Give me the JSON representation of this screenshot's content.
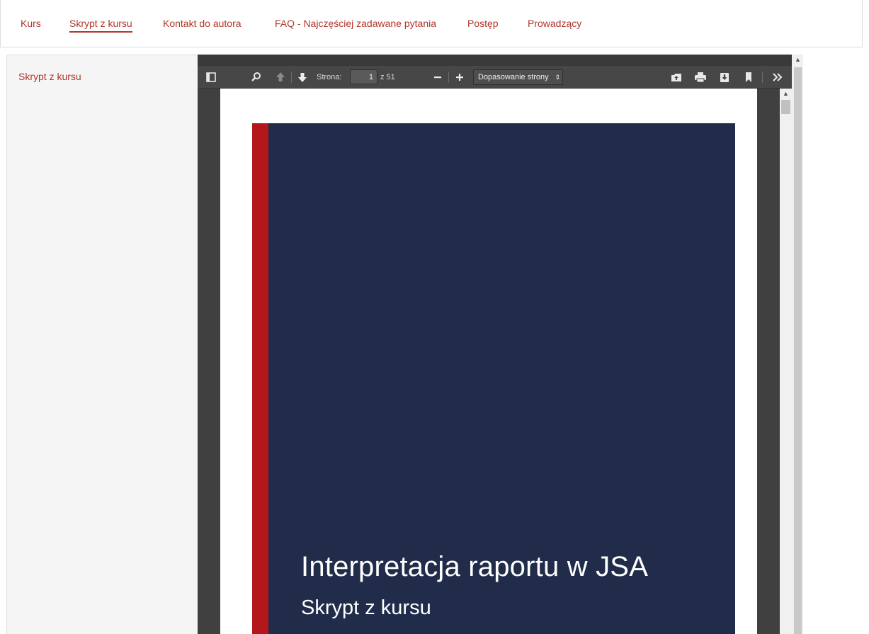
{
  "nav": {
    "tabs": [
      {
        "label": "Kurs",
        "active": false
      },
      {
        "label": "Skrypt z kursu",
        "active": true
      },
      {
        "label": "Kontakt do autora",
        "active": false
      },
      {
        "label": "FAQ - Najczęściej zadawane pytania",
        "active": false
      },
      {
        "label": "Postęp",
        "active": false
      },
      {
        "label": "Prowadzący",
        "active": false
      }
    ]
  },
  "sidebar": {
    "link": "Skrypt z kursu"
  },
  "viewer": {
    "page_label": "Strona:",
    "current_page": "1",
    "total_pages": "z 51",
    "zoom_value": "Dopasowanie strony",
    "icons": [
      "sidebar-toggle-icon",
      "search-icon",
      "previous-page-icon",
      "next-page-icon",
      "zoom-out-icon",
      "zoom-in-icon",
      "open-file-icon",
      "print-icon",
      "download-icon",
      "bookmark-icon",
      "more-tools-icon"
    ]
  },
  "document": {
    "title": "Interpretacja raportu w JSA",
    "subtitle": "Skrypt z kursu"
  },
  "colors": {
    "accent": "#b0352a",
    "cover_background": "#202c4a",
    "cover_band": "#b3161b"
  }
}
